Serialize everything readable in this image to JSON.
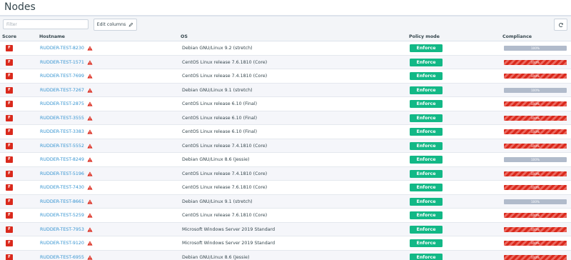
{
  "page": {
    "title": "Nodes"
  },
  "toolbar": {
    "filter_placeholder": "Filter",
    "edit_columns_label": "Edit columns"
  },
  "columns": {
    "score": "Score",
    "hostname": "Hostname",
    "os": "OS",
    "policy_mode": "Policy mode",
    "compliance": "Compliance"
  },
  "colors": {
    "link": "#3694d1",
    "score_error": "#da291c",
    "enforce": "#12b886",
    "compliance_error": "#da291c",
    "compliance_pending": "#b1bbcb"
  },
  "rows": [
    {
      "score": "F",
      "hostname": "RUDDER-TEST-8230",
      "os": "Debian GNU/Linux 9.2 (stretch)",
      "policy_mode": "Enforce",
      "compliance_status": "pending",
      "compliance_percent": 100,
      "compliance_label": "100%"
    },
    {
      "score": "F",
      "hostname": "RUDDER-TEST-1571",
      "os": "CentOS Linux release 7.6.1810 (Core)",
      "policy_mode": "Enforce",
      "compliance_status": "error",
      "compliance_percent": 100,
      "compliance_label": "100%"
    },
    {
      "score": "F",
      "hostname": "RUDDER-TEST-7699",
      "os": "CentOS Linux release 7.4.1810 (Core)",
      "policy_mode": "Enforce",
      "compliance_status": "error",
      "compliance_percent": 100,
      "compliance_label": "100%"
    },
    {
      "score": "F",
      "hostname": "RUDDER-TEST-7267",
      "os": "Debian GNU/Linux 9.1 (stretch)",
      "policy_mode": "Enforce",
      "compliance_status": "pending",
      "compliance_percent": 100,
      "compliance_label": "100%"
    },
    {
      "score": "F",
      "hostname": "RUDDER-TEST-2875",
      "os": "CentOS Linux release 6.10 (Final)",
      "policy_mode": "Enforce",
      "compliance_status": "error",
      "compliance_percent": 100,
      "compliance_label": "100%"
    },
    {
      "score": "F",
      "hostname": "RUDDER-TEST-3555",
      "os": "CentOS Linux release 6.10 (Final)",
      "policy_mode": "Enforce",
      "compliance_status": "error",
      "compliance_percent": 100,
      "compliance_label": "100%"
    },
    {
      "score": "F",
      "hostname": "RUDDER-TEST-3383",
      "os": "CentOS Linux release 6.10 (Final)",
      "policy_mode": "Enforce",
      "compliance_status": "error",
      "compliance_percent": 100,
      "compliance_label": "100%"
    },
    {
      "score": "F",
      "hostname": "RUDDER-TEST-5552",
      "os": "CentOS Linux release 7.4.1810 (Core)",
      "policy_mode": "Enforce",
      "compliance_status": "error",
      "compliance_percent": 100,
      "compliance_label": "100%"
    },
    {
      "score": "F",
      "hostname": "RUDDER-TEST-8249",
      "os": "Debian GNU/Linux 8.6 (Jessie)",
      "policy_mode": "Enforce",
      "compliance_status": "pending",
      "compliance_percent": 100,
      "compliance_label": "100%"
    },
    {
      "score": "F",
      "hostname": "RUDDER-TEST-5196",
      "os": "CentOS Linux release 7.4.1810 (Core)",
      "policy_mode": "Enforce",
      "compliance_status": "error",
      "compliance_percent": 100,
      "compliance_label": "100%"
    },
    {
      "score": "F",
      "hostname": "RUDDER-TEST-7430",
      "os": "CentOS Linux release 7.6.1810 (Core)",
      "policy_mode": "Enforce",
      "compliance_status": "error",
      "compliance_percent": 100,
      "compliance_label": "100%"
    },
    {
      "score": "F",
      "hostname": "RUDDER-TEST-8661",
      "os": "Debian GNU/Linux 9.1 (stretch)",
      "policy_mode": "Enforce",
      "compliance_status": "pending",
      "compliance_percent": 100,
      "compliance_label": "100%"
    },
    {
      "score": "F",
      "hostname": "RUDDER-TEST-5259",
      "os": "CentOS Linux release 7.6.1810 (Core)",
      "policy_mode": "Enforce",
      "compliance_status": "error",
      "compliance_percent": 100,
      "compliance_label": "100%"
    },
    {
      "score": "F",
      "hostname": "RUDDER-TEST-7953",
      "os": "Microsoft Windows Server 2019 Standard",
      "policy_mode": "Enforce",
      "compliance_status": "error",
      "compliance_percent": 100,
      "compliance_label": "100%"
    },
    {
      "score": "F",
      "hostname": "RUDDER-TEST-9120",
      "os": "Microsoft Windows Server 2019 Standard",
      "policy_mode": "Enforce",
      "compliance_status": "error",
      "compliance_percent": 100,
      "compliance_label": "100%"
    },
    {
      "score": "F",
      "hostname": "RUDDER-TEST-6955",
      "os": "Debian GNU/Linux 8.6 (Jessie)",
      "policy_mode": "Enforce",
      "compliance_status": "error",
      "compliance_percent": 100,
      "compliance_label": "100%"
    }
  ]
}
